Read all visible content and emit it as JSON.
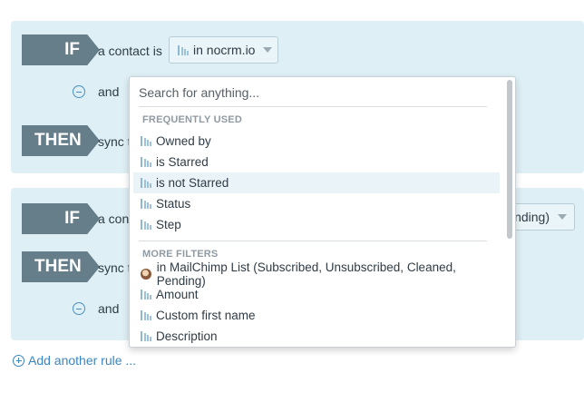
{
  "rule1": {
    "if_label": "IF",
    "if_text": "a contact is",
    "condition_value": "in nocrm.io",
    "and_label": "and",
    "then_label": "THEN",
    "then_text": "sync t"
  },
  "rule2": {
    "if_label": "IF",
    "if_text": "a con",
    "condition_value_partial": "ending)",
    "then_label": "THEN",
    "then_text": "sync t",
    "and_label": "and"
  },
  "dropdown": {
    "search_placeholder": "Search for anything...",
    "sections": [
      {
        "title": "FREQUENTLY USED",
        "items": [
          {
            "label": "Owned by",
            "icon": "nocrm-icon"
          },
          {
            "label": "is Starred",
            "icon": "nocrm-icon"
          },
          {
            "label": "is not Starred",
            "icon": "nocrm-icon",
            "highlighted": true
          },
          {
            "label": "Status",
            "icon": "nocrm-icon"
          },
          {
            "label": "Step",
            "icon": "nocrm-icon"
          }
        ]
      },
      {
        "title": "MORE FILTERS",
        "items": [
          {
            "label": "in MailChimp List (Subscribed, Unsubscribed, Cleaned, Pending)",
            "icon": "mailchimp-icon"
          },
          {
            "label": "Amount",
            "icon": "nocrm-icon"
          },
          {
            "label": "Custom first name",
            "icon": "nocrm-icon"
          },
          {
            "label": "Description",
            "icon": "nocrm-icon"
          }
        ]
      }
    ]
  },
  "add_rule_label": "Add another rule ...",
  "colors": {
    "rule_background": "#def0f5",
    "tag_background": "#667d8a",
    "link": "#3a86c1",
    "highlight": "#eaf3f8"
  }
}
